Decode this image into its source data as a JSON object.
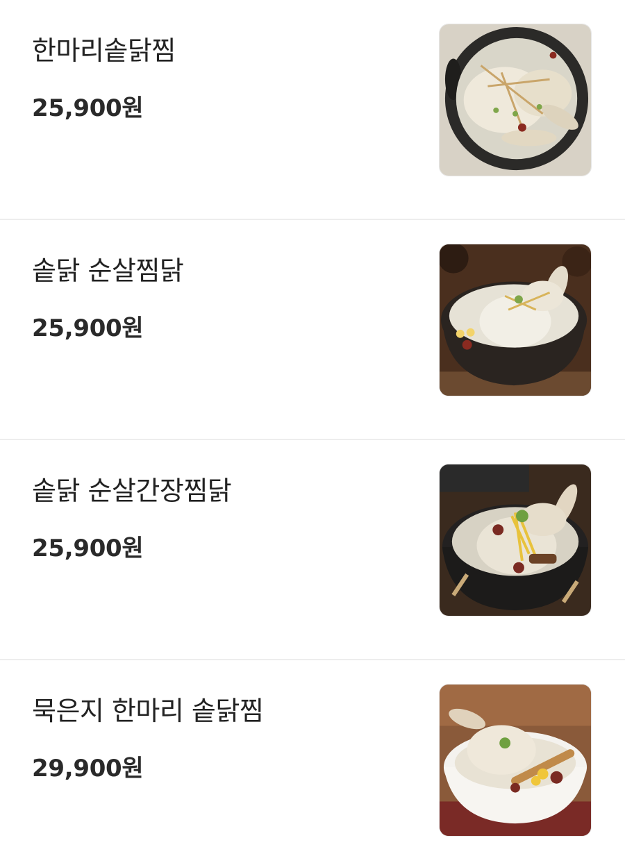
{
  "menu": {
    "items": [
      {
        "name": "한마리솥닭찜",
        "price": "25,900원",
        "image": "braised-chicken-in-black-pot-photo"
      },
      {
        "name": "솥닭 순살찜닭",
        "price": "25,900원",
        "image": "boneless-braised-chicken-in-stone-pot-photo"
      },
      {
        "name": "솥닭 순살간장찜닭",
        "price": "25,900원",
        "image": "soy-braised-chicken-with-ginseng-photo"
      },
      {
        "name": "묵은지 한마리 솥닭찜",
        "price": "29,900원",
        "image": "aged-kimchi-whole-chicken-in-white-bowl-photo"
      }
    ]
  }
}
